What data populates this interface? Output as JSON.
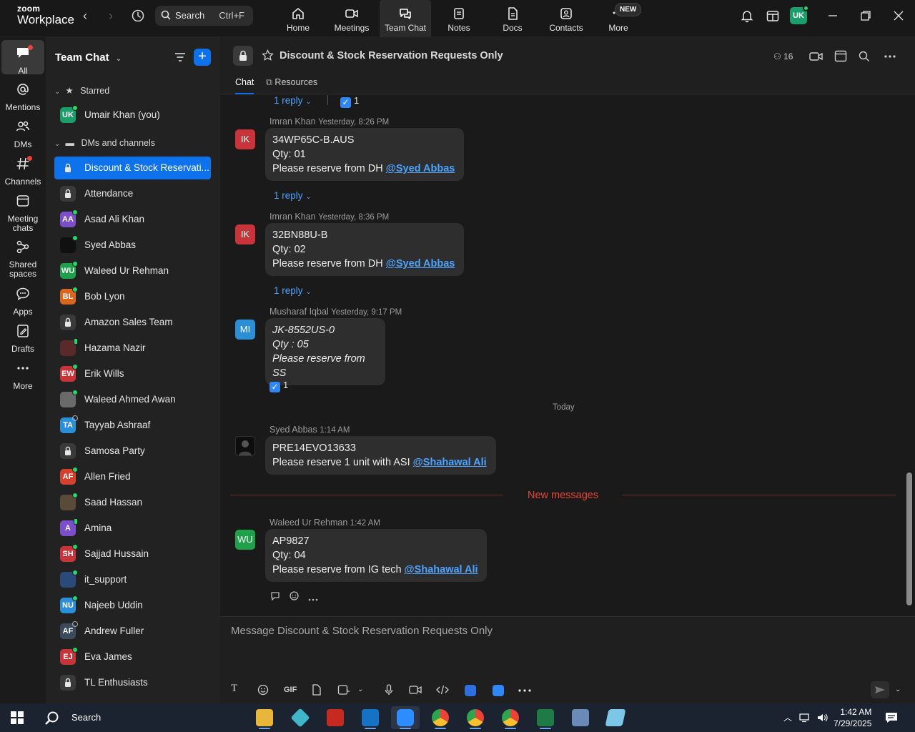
{
  "app": {
    "brand_top": "zoom",
    "brand_bottom": "Workplace"
  },
  "search": {
    "label": "Search",
    "shortcut": "Ctrl+F"
  },
  "nav_tabs": [
    {
      "label": "Home",
      "icon": "home-icon"
    },
    {
      "label": "Meetings",
      "icon": "video-icon"
    },
    {
      "label": "Team Chat",
      "icon": "chat-icon"
    },
    {
      "label": "Notes",
      "icon": "notes-icon"
    },
    {
      "label": "Docs",
      "icon": "docs-icon"
    },
    {
      "label": "Contacts",
      "icon": "contacts-icon"
    },
    {
      "label": "More",
      "icon": "more-icon"
    }
  ],
  "new_badge": "NEW",
  "user_initials": "UK",
  "rail": [
    {
      "label": "All"
    },
    {
      "label": "Mentions"
    },
    {
      "label": "DMs"
    },
    {
      "label": "Channels"
    },
    {
      "label": "Meeting chats"
    },
    {
      "label": "Shared spaces"
    },
    {
      "label": "Apps"
    },
    {
      "label": "Drafts"
    },
    {
      "label": "More"
    }
  ],
  "sidebar": {
    "title": "Team Chat",
    "starred_label": "Starred",
    "starred": [
      {
        "initials": "UK",
        "name": "Umair Khan (you)",
        "color": "#1a9e6b",
        "presence": "online"
      }
    ],
    "dms_label": "DMs and channels",
    "items": [
      {
        "initials": "",
        "name": "Discount & Stock Reservati...",
        "type": "channel",
        "selected": true
      },
      {
        "initials": "",
        "name": "Attendance",
        "type": "channel"
      },
      {
        "initials": "AA",
        "name": "Asad Ali Khan",
        "color": "#7b4fc8",
        "presence": "online"
      },
      {
        "initials": "",
        "name": "Syed Abbas",
        "color": "#101010",
        "presence": "online",
        "photo": true
      },
      {
        "initials": "WU",
        "name": "Waleed Ur Rehman",
        "color": "#1fa04a",
        "presence": "online"
      },
      {
        "initials": "BL",
        "name": "Bob Lyon",
        "color": "#d9661e",
        "presence": "online"
      },
      {
        "initials": "",
        "name": "Amazon Sales Team",
        "type": "channel"
      },
      {
        "initials": "",
        "name": "Hazama Nazir",
        "color": "#5a2a2a",
        "presence": "mobile",
        "photo": true
      },
      {
        "initials": "EW",
        "name": "Erik Wills",
        "color": "#c9333a",
        "presence": "online"
      },
      {
        "initials": "",
        "name": "Waleed Ahmed Awan",
        "color": "#6a6a6a",
        "presence": "online",
        "photo": true
      },
      {
        "initials": "TA",
        "name": "Tayyab Ashraaf",
        "color": "#2a8fd6",
        "presence": "offline"
      },
      {
        "initials": "",
        "name": "Samosa Party",
        "type": "channel"
      },
      {
        "initials": "AF",
        "name": "Allen Fried",
        "color": "#d6412e",
        "presence": "online"
      },
      {
        "initials": "",
        "name": "Saad Hassan",
        "color": "#5a4a3a",
        "presence": "online",
        "photo": true
      },
      {
        "initials": "A",
        "name": "Amina",
        "color": "#7b4fc8",
        "presence": "mobile"
      },
      {
        "initials": "SH",
        "name": "Sajjad Hussain",
        "color": "#c9333a",
        "presence": "online"
      },
      {
        "initials": "",
        "name": "it_support",
        "color": "#2a4a7a",
        "presence": "online",
        "photo": true
      },
      {
        "initials": "NU",
        "name": "Najeeb Uddin",
        "color": "#2a8fd6",
        "presence": "online"
      },
      {
        "initials": "AF",
        "name": "Andrew Fuller",
        "color": "#3a4a5a",
        "presence": "offline"
      },
      {
        "initials": "EJ",
        "name": "Eva James",
        "color": "#c9333a",
        "presence": "online"
      },
      {
        "initials": "",
        "name": "TL Enthusiasts",
        "type": "channel"
      }
    ]
  },
  "channel": {
    "title": "Discount & Stock Reservation Requests Only",
    "member_count": "16",
    "tabs": [
      "Chat",
      "Resources"
    ]
  },
  "messages": {
    "top_reply": "1 reply",
    "top_check_count": "1",
    "m1": {
      "author": "Imran Khan",
      "time": "Yesterday, 8:26 PM",
      "initials": "IK",
      "lines": [
        "34WP65C-B.AUS",
        "Qty: 01"
      ],
      "last_prefix": "Please reserve from DH ",
      "mention": "@Syed Abbas",
      "reply": "1 reply"
    },
    "m2": {
      "author": "Imran Khan",
      "time": "Yesterday, 8:36 PM",
      "initials": "IK",
      "lines": [
        "32BN88U-B",
        "Qty: 02"
      ],
      "last_prefix": "Please reserve from DH ",
      "mention": "@Syed Abbas",
      "reply": "1 reply"
    },
    "m3": {
      "author": "Musharaf Iqbal",
      "time": "Yesterday, 9:17 PM",
      "initials": "MI",
      "lines": [
        "JK-8552US-0",
        "Qty : 05",
        "Please reserve from SS"
      ],
      "check_count": "1"
    },
    "day_separator": "Today",
    "m4": {
      "author": "Syed Abbas",
      "time": "1:14 AM",
      "lines": [
        "PRE14EVO13633"
      ],
      "last_prefix": "Please reserve 1 unit with ASI ",
      "mention": "@Shahawal Ali"
    },
    "new_messages": "New messages",
    "m5": {
      "author": "Waleed Ur Rehman",
      "time": "1:42 AM",
      "initials": "WU",
      "lines": [
        "AP9827",
        "Qty: 04"
      ],
      "last_prefix": "Please reserve from IG tech ",
      "mention": "@Shahawal Ali"
    }
  },
  "composer": {
    "placeholder": "Message Discount & Stock Reservation Requests Only",
    "gif_label": "GIF"
  },
  "taskbar": {
    "search_label": "Search",
    "time": "1:42 AM",
    "date": "7/29/2025"
  },
  "colors": {
    "accent": "#0e72ed",
    "link": "#4da3ff",
    "new_messages": "#e8443a"
  }
}
